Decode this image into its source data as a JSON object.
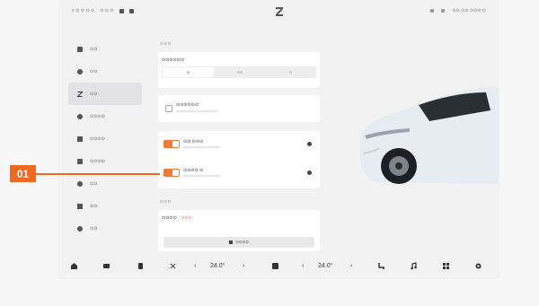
{
  "status_bar": {
    "left_items": [
      "≡ ⊙ ⊙ ⊙ ⊙",
      "⊙ ⊙ ⊙"
    ],
    "right_text": "⊙⊙ ⊙⊙ ⊙⊙⊙ ⊙"
  },
  "sidebar": {
    "items": [
      {
        "label": "⊙⊙",
        "icon": "car-icon"
      },
      {
        "label": "⊙⊙",
        "icon": "light-icon"
      },
      {
        "label": "⊙⊙",
        "icon": "z-icon",
        "active": true
      },
      {
        "label": "⊙⊙⊙⊙",
        "icon": "drive-icon"
      },
      {
        "label": "⊙⊙⊙⊙",
        "icon": "charge-icon"
      },
      {
        "label": "⊙⊙⊙⊙",
        "icon": "seat-icon"
      },
      {
        "label": "⊙⊙",
        "icon": "lock-icon"
      },
      {
        "label": "⊙⊙",
        "icon": "sound-icon"
      },
      {
        "label": "⊙⊙",
        "icon": "display-icon"
      },
      {
        "label": "⊙⊙",
        "icon": "settings-icon"
      }
    ]
  },
  "content": {
    "section1_title": "⊙⊙⊙",
    "card1_title": "⊙⊙⊙⊙⊙⊙",
    "segments": [
      "⊙",
      "⊙⊙",
      "⊙"
    ],
    "card2_title": "⊙⊙⊙⊙⊙⊙",
    "card2_sub": "⊙⊙⊙⊙⊙⊙⊙⊙⊙⊙⊙⊙⊙⊙⊙⊙",
    "row1_title": "⊙⊙ ⊙⊙⊙",
    "row1_sub": "⊙⊙⊙⊙⊙⊙⊙⊙⊙⊙⊙⊙⊙⊙",
    "row2_title": "⊙⊙⊙⊙ ⊙",
    "row2_sub": "⊙⊙⊙⊙⊙⊙⊙⊙⊙⊙⊙⊙⊙⊙",
    "section2_title": "⊙⊙⊙",
    "card3_title": "⊙⊙⊙⊙",
    "card3_highlight": "⊙⊙⊙",
    "card3_button": "⊙⊙⊙⊙"
  },
  "bottom_bar": {
    "temp_left": "24.0°",
    "temp_right": "24.0°"
  },
  "callout": {
    "label": "01",
    "color": "#ee6a23"
  },
  "colors": {
    "accent": "#f07a3a"
  }
}
